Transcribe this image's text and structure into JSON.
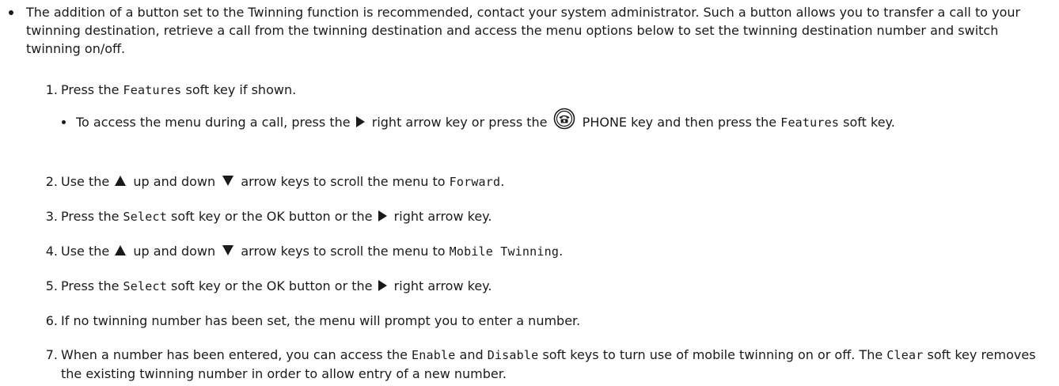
{
  "intro": "The addition of a button set to the Twinning function is recommended, contact your system administrator. Such a button allows you to transfer a call to your twinning destination, retrieve a call from the twinning destination and access the menu options below to set the twinning destination number and switch twinning on/off.",
  "steps": [
    {
      "num": "1.",
      "a": "Press the ",
      "key": "Features",
      "b": " soft key if shown."
    },
    {
      "num": "2.",
      "a": "Use the ",
      "b": " up and down ",
      "c": " arrow keys to scroll the menu to ",
      "key": "Forward",
      "d": "."
    },
    {
      "num": "3.",
      "a": "Press the ",
      "key": "Select",
      "b": " soft key or the OK button or the ",
      "c": " right arrow key."
    },
    {
      "num": "4.",
      "a": "Use the ",
      "b": " up and down ",
      "c": " arrow keys to scroll the menu to ",
      "key": "Mobile Twinning",
      "d": "."
    },
    {
      "num": "5.",
      "a": "Press the ",
      "key": "Select",
      "b": " soft key or the OK button or the ",
      "c": " right arrow key."
    },
    {
      "num": "6.",
      "a": "If no twinning number has been set, the menu will prompt you to enter a number."
    },
    {
      "num": "7.",
      "a": "When a number has been entered, you can access the ",
      "key1": "Enable",
      "b": " and ",
      "key2": "Disable",
      "c": " soft keys to turn use of mobile twinning on or off. The ",
      "key3": "Clear",
      "d": " soft key removes the existing twinning number in order to allow entry of a new number."
    }
  ],
  "sub": {
    "a": "To access the menu during a call, press the ",
    "b": " right arrow key or press the ",
    "c": " PHONE key and then press the ",
    "key": "Features",
    "d": " soft key."
  },
  "icons": {
    "right_arrow": "right-triangle-icon",
    "up_arrow": "up-triangle-icon",
    "down_arrow": "down-triangle-icon",
    "phone": "phone-key-icon"
  }
}
